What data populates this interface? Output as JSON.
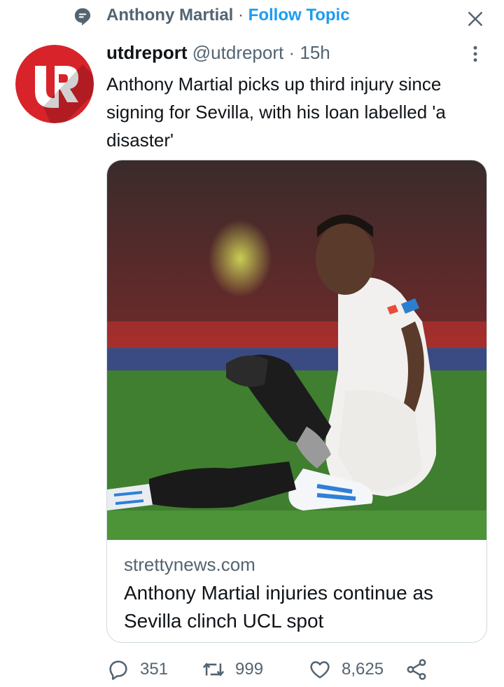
{
  "topic": {
    "label": "Anthony Martial",
    "separator": " · ",
    "action": "Follow Topic"
  },
  "tweet": {
    "author_name": "utdreport",
    "handle": "@utdreport",
    "separator": " · ",
    "time": "15h",
    "text": "Anthony Martial picks up third injury since signing for Sevilla, with his loan labelled 'a disaster'"
  },
  "card": {
    "domain": "strettynews.com",
    "title": "Anthony Martial injuries continue as Sevilla clinch UCL spot",
    "image_alt": "Football player in white kit sitting on the pitch holding his boot"
  },
  "actions": {
    "replies": "351",
    "retweets": "999",
    "likes": "8,625"
  },
  "colors": {
    "accent": "#1d9bf0",
    "secondary_text": "#536471",
    "avatar_red": "#d8232a"
  },
  "icons": [
    "topic-icon",
    "close-icon",
    "more-icon",
    "reply-icon",
    "retweet-icon",
    "like-icon",
    "share-icon"
  ]
}
